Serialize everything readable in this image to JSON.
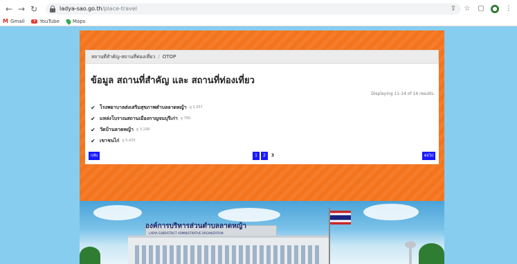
{
  "browser": {
    "url_host": "ladya-sao.go.th",
    "url_path": "/place-travel",
    "bookmarks": [
      {
        "label": "Gmail"
      },
      {
        "label": "YouTube"
      },
      {
        "label": "Maps"
      }
    ]
  },
  "breadcrumb": {
    "item1": "สถานที่สำคัญ-สถานที่ท่องเที่ยว",
    "item2": "OTOP"
  },
  "page": {
    "title": "ข้อมูล สถานที่สำคัญ และ สถานที่ท่องเที่ยว",
    "summary": "Displaying 11-14 of 14 results."
  },
  "places": [
    {
      "name": "โรงพยาบาลส่งเสริมสุขภาพตำบลลาดหญ้า",
      "views": "ดู 1,357"
    },
    {
      "name": "แหล่งโบราณสถานเมืองกาญจนบุรีเก่า",
      "views": "ดู 790"
    },
    {
      "name": "วัดบ้านลาดหญ้า",
      "views": "ดู 3,199"
    },
    {
      "name": "เขาชนไก่",
      "views": "ดู 5,433"
    }
  ],
  "pagination": {
    "back_label": "กลับ",
    "next_label": "ต่อไป",
    "pages": [
      "1",
      "2",
      "3"
    ],
    "current_page": "3"
  },
  "photo": {
    "sign_th": "องค์การบริหารส่วนตำบลลาดหญ้า",
    "sign_en": "LADYA SUBDISTRICT ADMINISTRATIVE ORGANIZATION"
  },
  "colors": {
    "banner": "#f3741d",
    "background": "#87cdf0",
    "button": "#1a1aff"
  }
}
